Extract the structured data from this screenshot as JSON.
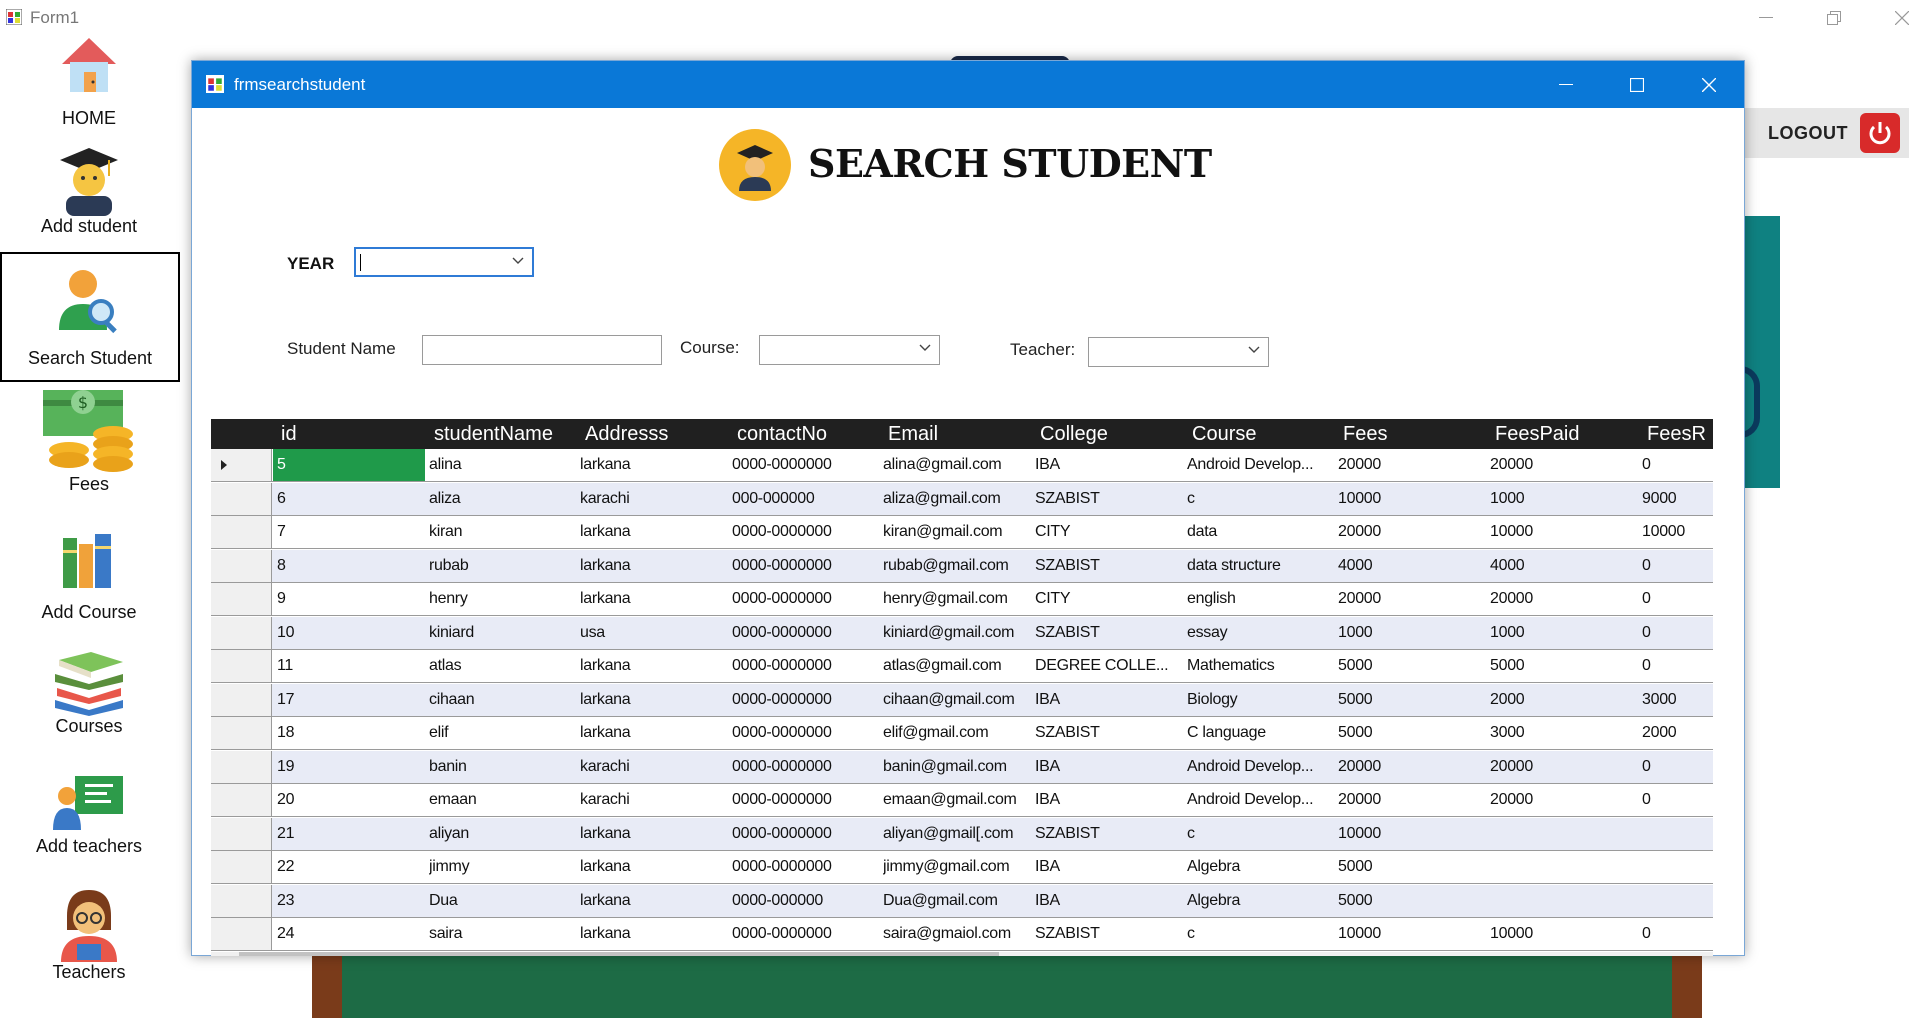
{
  "main_window": {
    "title": "Form1"
  },
  "logout": {
    "label": "LOGOUT"
  },
  "nav": {
    "items": [
      {
        "label": "HOME",
        "icon": "home-icon"
      },
      {
        "label": "Add student",
        "icon": "graduate-icon"
      },
      {
        "label": "Search Student",
        "icon": "search-person-icon",
        "selected": true
      },
      {
        "label": "Fees",
        "icon": "money-icon"
      },
      {
        "label": "Add Course",
        "icon": "books-icon"
      },
      {
        "label": "Courses",
        "icon": "book-stack-icon"
      },
      {
        "label": "Add teachers",
        "icon": "teacher-board-icon"
      },
      {
        "label": "Teachers",
        "icon": "teacher-icon"
      }
    ]
  },
  "child_window": {
    "title": "frmsearchstudent",
    "header_title": "SEARCH STUDENT",
    "year_label": "YEAR",
    "year_value": "",
    "student_name_label": "Student Name",
    "student_name_value": "",
    "course_label": "Course:",
    "course_value": "",
    "teacher_label": "Teacher:",
    "teacher_value": ""
  },
  "grid": {
    "columns": [
      "id",
      "studentName",
      "Addresss",
      "contactNo",
      "Email",
      "College",
      "Course",
      "Fees",
      "FeesPaid",
      "FeesR"
    ],
    "rows": [
      [
        "5",
        "alina",
        "larkana",
        "0000-0000000",
        "alina@gmail.com",
        "IBA",
        "Android Develop...",
        "20000",
        "20000",
        "0"
      ],
      [
        "6",
        "aliza",
        "karachi",
        "000-000000",
        "aliza@gmail.com",
        "SZABIST",
        "c",
        "10000",
        "1000",
        "9000"
      ],
      [
        "7",
        "kiran",
        "larkana",
        "0000-0000000",
        "kiran@gmail.com",
        "CITY",
        "data",
        "20000",
        "10000",
        "10000"
      ],
      [
        "8",
        "rubab",
        "larkana",
        "0000-0000000",
        "rubab@gmail.com",
        "SZABIST",
        "data structure",
        "4000",
        "4000",
        "0"
      ],
      [
        "9",
        "henry",
        "larkana",
        "0000-0000000",
        "henry@gmail.com",
        "CITY",
        "english",
        "20000",
        "20000",
        "0"
      ],
      [
        "10",
        "kiniard",
        "usa",
        "0000-0000000",
        "kiniard@gmail.com",
        "SZABIST",
        "essay",
        "1000",
        "1000",
        "0"
      ],
      [
        "11",
        "atlas",
        "larkana",
        "0000-0000000",
        "atlas@gmail.com",
        "DEGREE COLLE...",
        "Mathematics",
        "5000",
        "5000",
        "0"
      ],
      [
        "17",
        "cihaan",
        "larkana",
        "0000-0000000",
        "cihaan@gmail.com",
        "IBA",
        "Biology",
        "5000",
        "2000",
        "3000"
      ],
      [
        "18",
        "elif",
        "larkana",
        "0000-0000000",
        "elif@gmail.com",
        "SZABIST",
        "C language",
        "5000",
        "3000",
        "2000"
      ],
      [
        "19",
        "banin",
        "karachi",
        "0000-0000000",
        "banin@gmail.com",
        "IBA",
        "Android Develop...",
        "20000",
        "20000",
        "0"
      ],
      [
        "20",
        "emaan",
        "karachi",
        "0000-0000000",
        "emaan@gmail.com",
        "IBA",
        "Android Develop...",
        "20000",
        "20000",
        "0"
      ],
      [
        "21",
        "aliyan",
        "larkana",
        "0000-0000000",
        "aliyan@gmail[.com",
        "SZABIST",
        "c",
        "10000",
        "",
        ""
      ],
      [
        "22",
        "jimmy",
        "larkana",
        "0000-0000000",
        "jimmy@gmail.com",
        "IBA",
        "Algebra",
        "5000",
        "",
        ""
      ],
      [
        "23",
        "Dua",
        "larkana",
        "0000-000000",
        "Dua@gmail.com",
        "IBA",
        "Algebra",
        "5000",
        "",
        ""
      ],
      [
        "24",
        "saira",
        "larkana",
        "0000-0000000",
        "saira@gmaiol.com",
        "SZABIST",
        "c",
        "10000",
        "10000",
        "0"
      ]
    ],
    "selected_row": 0
  },
  "colors": {
    "titlebar": "#0a78d7",
    "grid_header": "#202020",
    "alt_row": "#e8ebf6",
    "selected_cell": "#1f9a4a",
    "logo_bg": "#f5b527"
  }
}
